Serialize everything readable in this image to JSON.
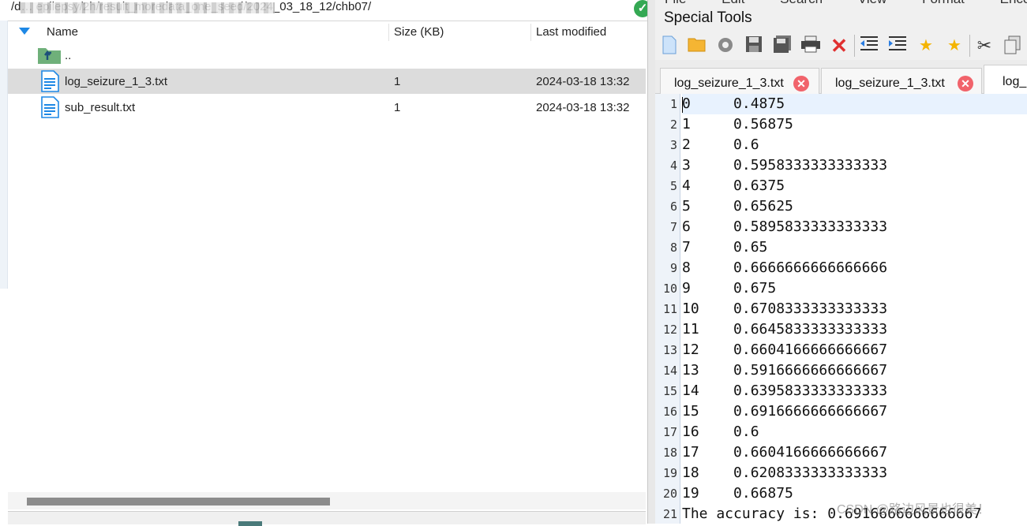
{
  "file_browser": {
    "path": "/d… epilepsy/2h/result_moredata_one_seed/2024_03_18_12/chb07/",
    "columns": {
      "name": "Name",
      "size": "Size (KB)",
      "modified": "Last modified"
    },
    "parent_label": "..",
    "files": [
      {
        "name": "log_seizure_1_3.txt",
        "size": "1",
        "modified": "2024-03-18 13:32",
        "selected": true
      },
      {
        "name": "sub_result.txt",
        "size": "1",
        "modified": "2024-03-18 13:32",
        "selected": false
      }
    ]
  },
  "editor": {
    "menu_partial": [
      "File",
      "Edit",
      "Search",
      "View",
      "Format",
      "Encod"
    ],
    "special_tools": "Special Tools",
    "toolbar_icons": [
      "new-file-icon",
      "open-folder-icon",
      "reload-icon",
      "save-icon",
      "save-all-icon",
      "print-icon",
      "close-icon",
      "outdent-icon",
      "indent-icon",
      "bookmark-star-icon",
      "bookmark-next-icon",
      "cut-icon",
      "copy-icon"
    ],
    "tabs": [
      {
        "label": "log_seizure_1_3.txt"
      },
      {
        "label": "log_seizure_1_3.txt"
      },
      {
        "label": "log_"
      }
    ],
    "lines": [
      "0\t0.4875",
      "1\t0.56875",
      "2\t0.6",
      "3\t0.5958333333333333",
      "4\t0.6375",
      "5\t0.65625",
      "6\t0.5895833333333333",
      "7\t0.65",
      "8\t0.6666666666666666",
      "9\t0.675",
      "10\t0.6708333333333333",
      "11\t0.6645833333333333",
      "12\t0.6604166666666667",
      "13\t0.5916666666666667",
      "14\t0.6395833333333333",
      "15\t0.6916666666666667",
      "16\t0.6",
      "17\t0.6604166666666667",
      "18\t0.6208333333333333",
      "19\t0.66875",
      "The accuracy is: 0.6916666666666667"
    ],
    "watermark": "CSDN @路边风景也很美！"
  },
  "colors": {
    "accent": "#1e88e5",
    "selected_row": "#dcdcdc",
    "current_line": "#e8f2fe",
    "tab_close": "#f1636b",
    "ok_green": "#34a853"
  }
}
